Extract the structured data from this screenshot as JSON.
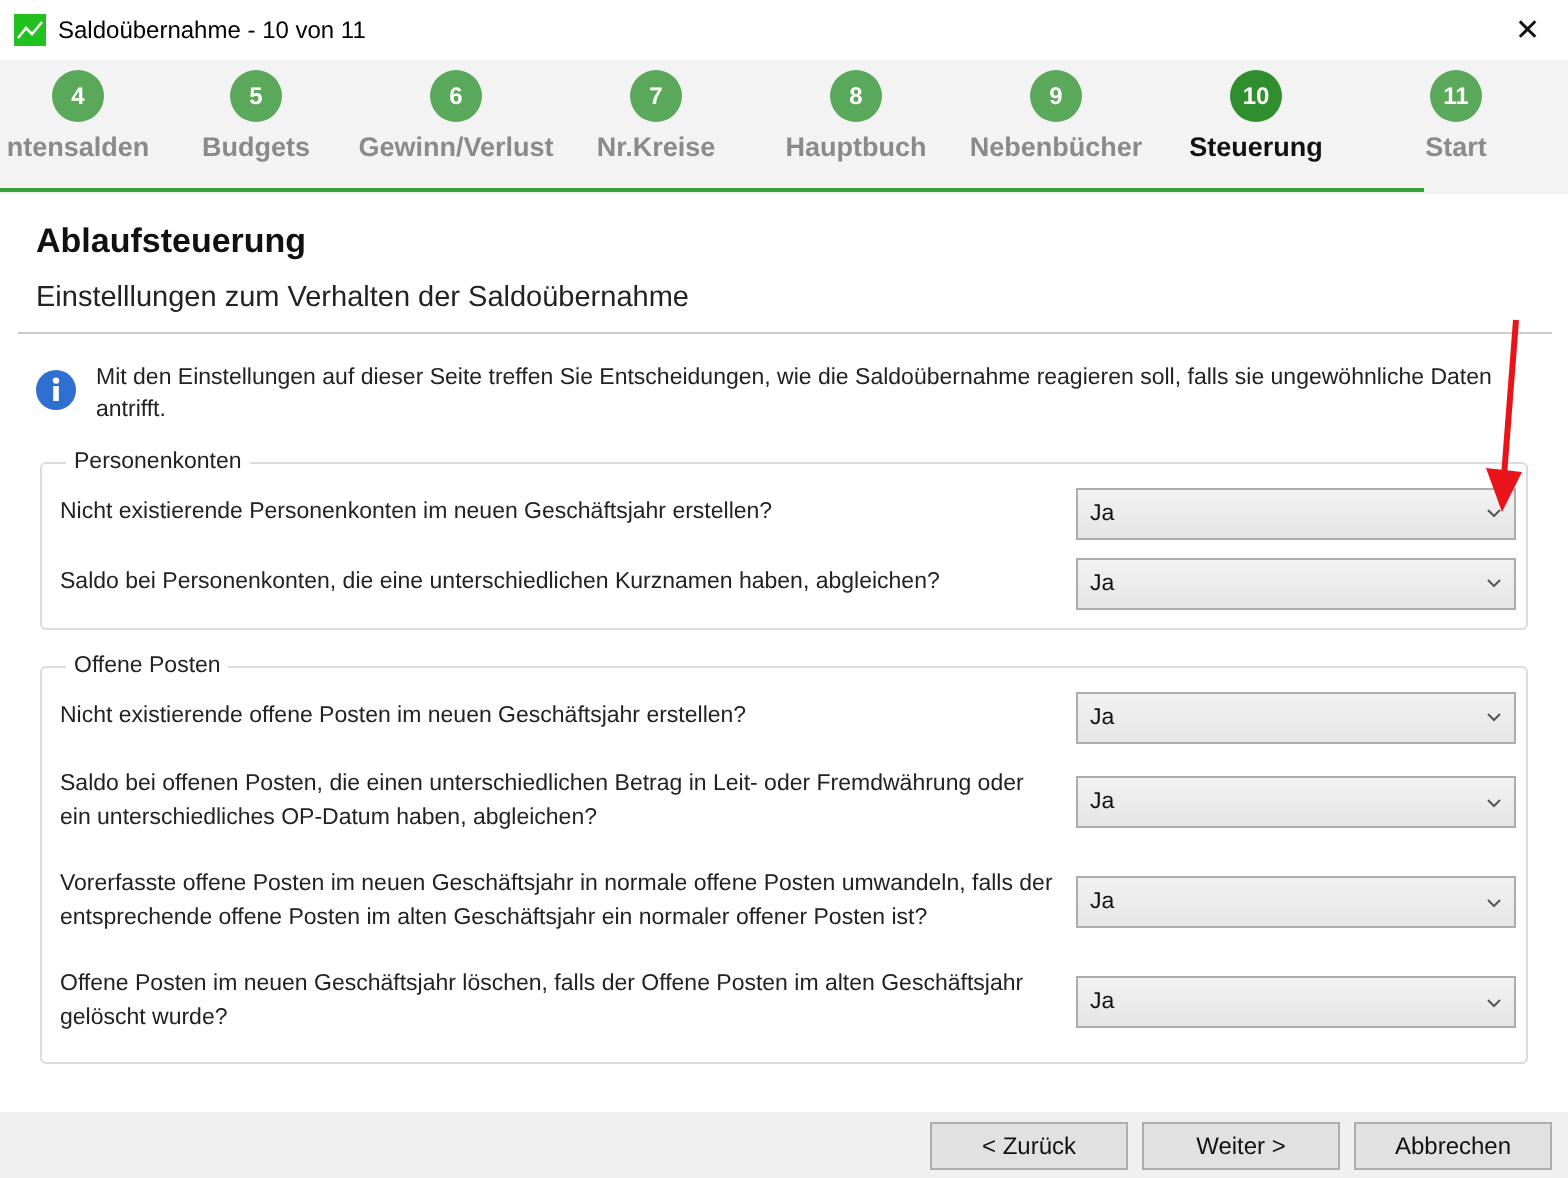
{
  "window": {
    "title": "Saldoübernahme - 10 von 11",
    "close": "✕"
  },
  "steps": [
    {
      "number": "4",
      "label": "ntensalden",
      "selected": false
    },
    {
      "number": "5",
      "label": "Budgets",
      "selected": false
    },
    {
      "number": "6",
      "label": "Gewinn/Verlust",
      "selected": false
    },
    {
      "number": "7",
      "label": "Nr.Kreise",
      "selected": false
    },
    {
      "number": "8",
      "label": "Hauptbuch",
      "selected": false
    },
    {
      "number": "9",
      "label": "Nebenbücher",
      "selected": false
    },
    {
      "number": "10",
      "label": "Steuerung",
      "selected": true
    },
    {
      "number": "11",
      "label": "Start",
      "selected": false
    }
  ],
  "progress": {
    "level": 0.908
  },
  "heading": "Ablaufsteuerung",
  "subheading": "Einstelllungen zum Verhalten der Saldoübernahme",
  "info": "Mit den Einstellungen auf dieser Seite treffen Sie Entscheidungen, wie die Saldoübernahme reagieren soll, falls sie ungewöhnliche Daten antrifft.",
  "groups": [
    {
      "title": "Personenkonten",
      "rows": [
        {
          "question": "Nicht existierende Personenkonten im neuen Geschäftsjahr erstellen?",
          "value": "Ja"
        },
        {
          "question": "Saldo bei Personenkonten, die eine unterschiedlichen Kurznamen haben, abgleichen?",
          "value": "Ja"
        }
      ]
    },
    {
      "title": "Offene Posten",
      "rows": [
        {
          "question": "Nicht existierende offene Posten im neuen Geschäftsjahr erstellen?",
          "value": "Ja"
        },
        {
          "question": "Saldo bei offenen Posten, die einen unterschiedlichen Betrag in Leit- oder Fremdwährung oder ein unterschiedliches OP-Datum haben, abgleichen?",
          "value": "Ja"
        },
        {
          "question": "Vorerfasste offene Posten im neuen Geschäftsjahr in normale offene Posten umwandeln, falls der entsprechende offene Posten im alten Geschäftsjahr ein normaler offener Posten ist?",
          "value": "Ja"
        },
        {
          "question": "Offene Posten im neuen Geschäftsjahr löschen, falls der Offene Posten im alten Geschäftsjahr gelöscht wurde?",
          "value": "Ja"
        }
      ]
    }
  ],
  "buttons": [
    "< Zurück",
    "Weiter >",
    "Abbrechen"
  ]
}
